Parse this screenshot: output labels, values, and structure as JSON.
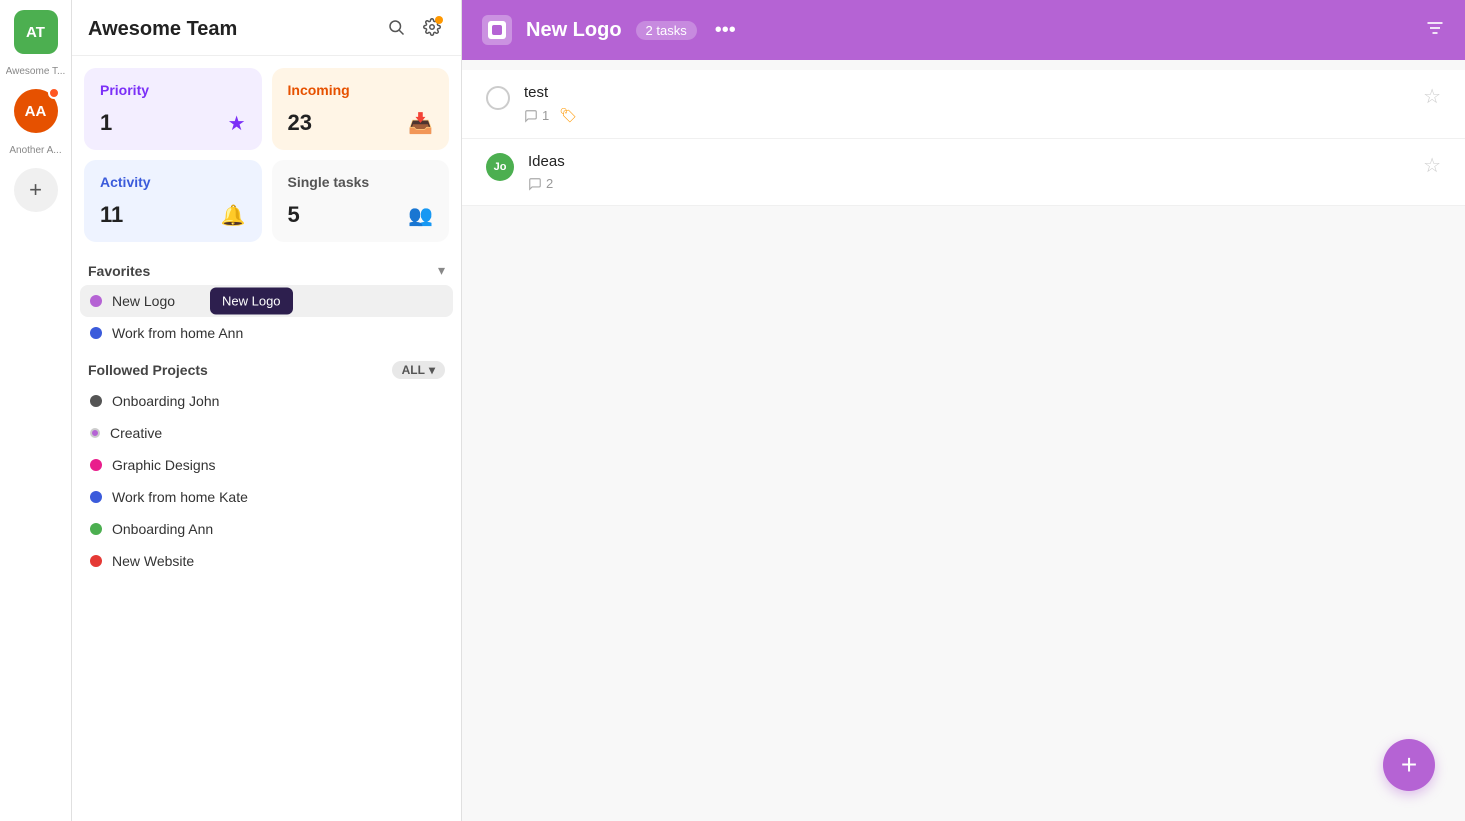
{
  "iconBar": {
    "at_label": "AT",
    "at_sublabel": "Awesome T...",
    "aa_label": "AA",
    "aa_sublabel": "Another A..."
  },
  "sidebar": {
    "title": "Awesome Team",
    "search_tooltip": "search",
    "settings_tooltip": "settings",
    "stats": [
      {
        "id": "priority",
        "label": "Priority",
        "value": "1",
        "icon": "★",
        "color": "purple"
      },
      {
        "id": "incoming",
        "label": "Incoming",
        "value": "23",
        "icon": "📥",
        "color": "orange"
      },
      {
        "id": "activity",
        "label": "Activity",
        "value": "11",
        "icon": "🔔",
        "color": "blue"
      },
      {
        "id": "single",
        "label": "Single tasks",
        "value": "5",
        "icon": "👥",
        "color": "light"
      }
    ],
    "favorites_label": "Favorites",
    "favorites": [
      {
        "id": "new-logo",
        "label": "New Logo",
        "color": "#b563d4",
        "active": true,
        "tooltip": "New Logo"
      },
      {
        "id": "work-from-home-ann",
        "label": "Work from home Ann",
        "color": "#3b5bdb",
        "active": false,
        "tooltip": null
      }
    ],
    "followed_label": "Followed Projects",
    "followed_filter": "ALL",
    "projects": [
      {
        "id": "onboarding-john",
        "label": "Onboarding John",
        "color": "#555"
      },
      {
        "id": "creative",
        "label": "Creative",
        "color": "#b563d4"
      },
      {
        "id": "graphic-designs",
        "label": "Graphic Designs",
        "color": "#e91e8c"
      },
      {
        "id": "work-from-home-kate",
        "label": "Work from home Kate",
        "color": "#3b5bdb"
      },
      {
        "id": "onboarding-ann",
        "label": "Onboarding Ann",
        "color": "#4CAF50"
      },
      {
        "id": "new-website",
        "label": "New Website",
        "color": "#e53935"
      }
    ]
  },
  "main": {
    "project_name": "New Logo",
    "tasks_count": "2 tasks",
    "more_label": "•••",
    "filter_icon": "filter",
    "tasks": [
      {
        "id": "test",
        "name": "test",
        "comments": "1",
        "has_tag": true,
        "avatar": null,
        "avatar_initials": null
      },
      {
        "id": "ideas",
        "name": "Ideas",
        "comments": "2",
        "has_tag": false,
        "avatar": "Jo",
        "avatar_color": "#4CAF50"
      }
    ]
  },
  "fab": {
    "label": "+"
  }
}
